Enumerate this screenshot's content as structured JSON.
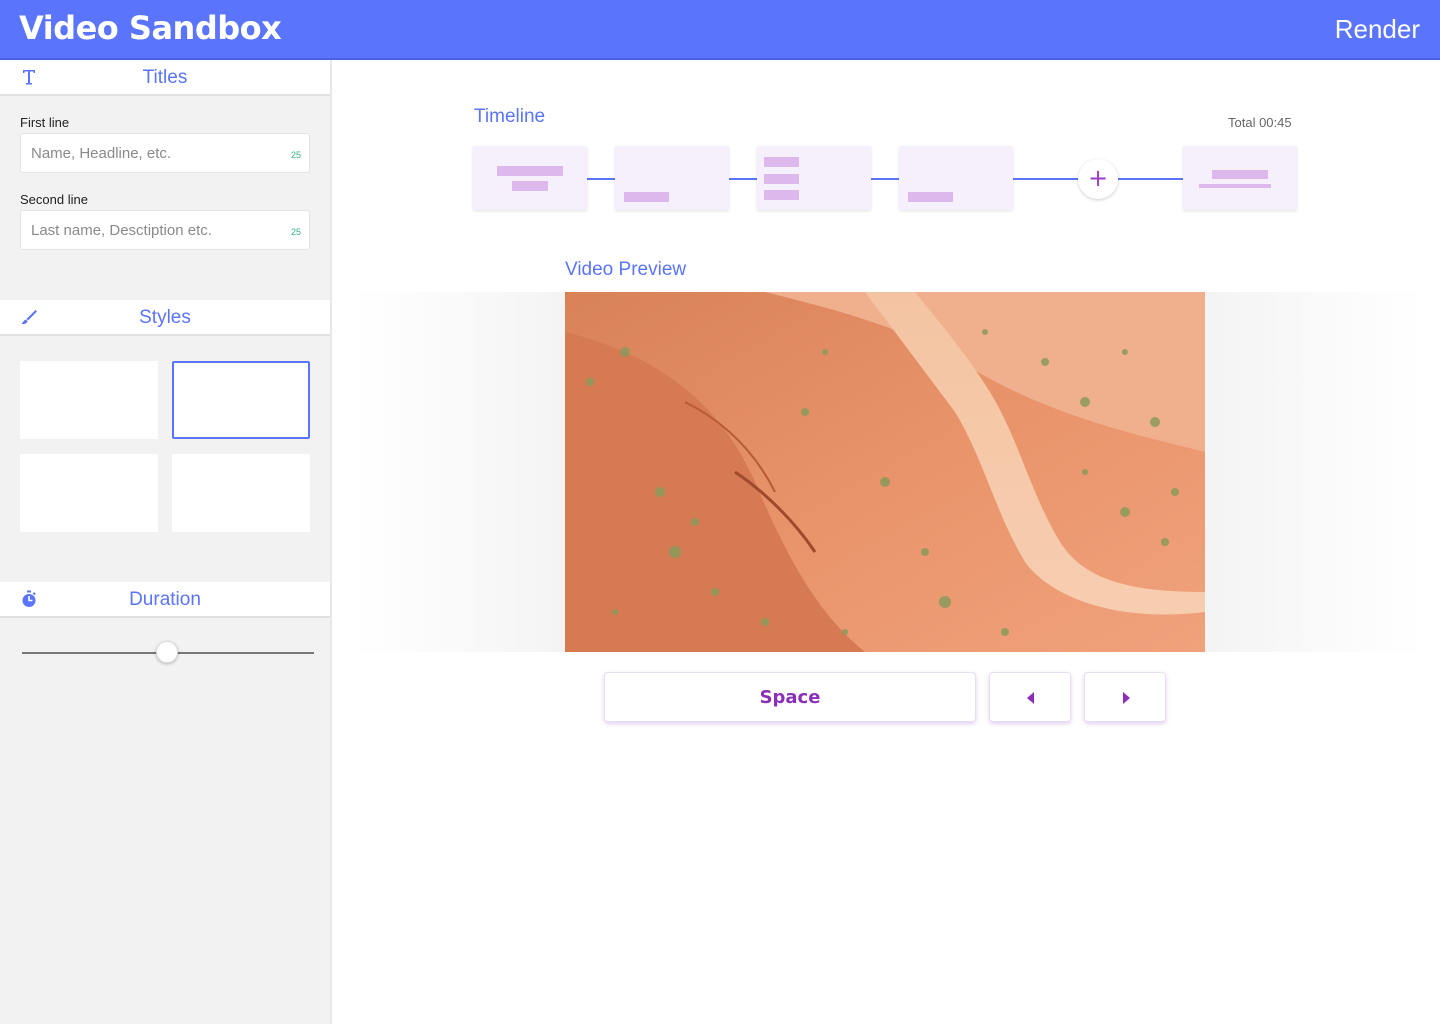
{
  "header": {
    "app_title": "Video Sandbox",
    "render_label": "Render",
    "accent_color": "#5b74fc"
  },
  "sidebar": {
    "titles": {
      "heading": "Titles",
      "icon": "text-t-icon",
      "first_line_label": "First line",
      "first_line_placeholder": "Name, Headline, etc.",
      "first_line_counter": "25",
      "second_line_label": "Second line",
      "second_line_placeholder": "Last name, Desctiption etc.",
      "second_line_counter": "25"
    },
    "styles": {
      "heading": "Styles",
      "icon": "brush-icon",
      "options": [
        {
          "selected": false
        },
        {
          "selected": true
        },
        {
          "selected": false
        },
        {
          "selected": false
        }
      ]
    },
    "duration": {
      "heading": "Duration",
      "icon": "stopwatch-icon",
      "slider_fraction": 0.5
    }
  },
  "timeline": {
    "label": "Timeline",
    "total": "Total 00:45",
    "clips": [
      {
        "layout": "centered-title"
      },
      {
        "layout": "lower-bar"
      },
      {
        "layout": "stacked-bars"
      },
      {
        "layout": "lower-bar"
      },
      {
        "layout": "title-underline"
      }
    ],
    "add_icon": "plus-icon"
  },
  "preview": {
    "label": "Video Preview",
    "image_subject": "aerial view of orange desert canyon with dirt road"
  },
  "controls": {
    "space_label": "Space",
    "prev_icon": "caret-left-icon",
    "next_icon": "caret-right-icon",
    "button_text_color": "#8b2fb8"
  }
}
